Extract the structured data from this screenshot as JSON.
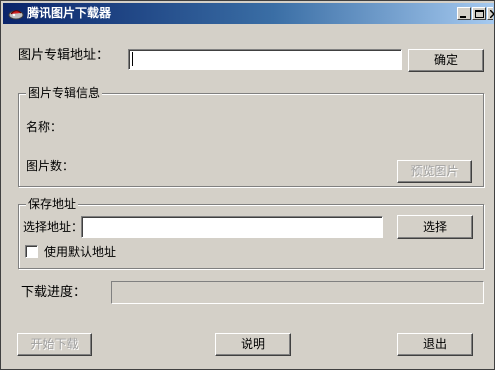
{
  "window": {
    "title": "腾讯图片下载器",
    "controls": [
      "minimize-icon",
      "maximize-icon",
      "close-icon"
    ]
  },
  "album": {
    "address_label": "图片专辑地址：",
    "address_value": "",
    "confirm_label": "确定"
  },
  "info_group": {
    "title": "图片专辑信息",
    "name_label": "名称：",
    "name_value": "",
    "count_label": "图片数：",
    "count_value": "",
    "preview_label": "预览图片"
  },
  "save_group": {
    "title": "保存地址",
    "select_label": "选择地址：",
    "select_value": "",
    "select_button_label": "选择",
    "default_checkbox_label": "使用默认地址",
    "default_checked": false
  },
  "progress": {
    "label": "下载进度：",
    "value": 0
  },
  "footer": {
    "start_label": "开始下载",
    "help_label": "说明",
    "exit_label": "退出"
  },
  "colors": {
    "face": "#d4d0c8",
    "title_start": "#0a246a",
    "title_end": "#a6caf0",
    "disabled_text": "#a0a0a0"
  }
}
